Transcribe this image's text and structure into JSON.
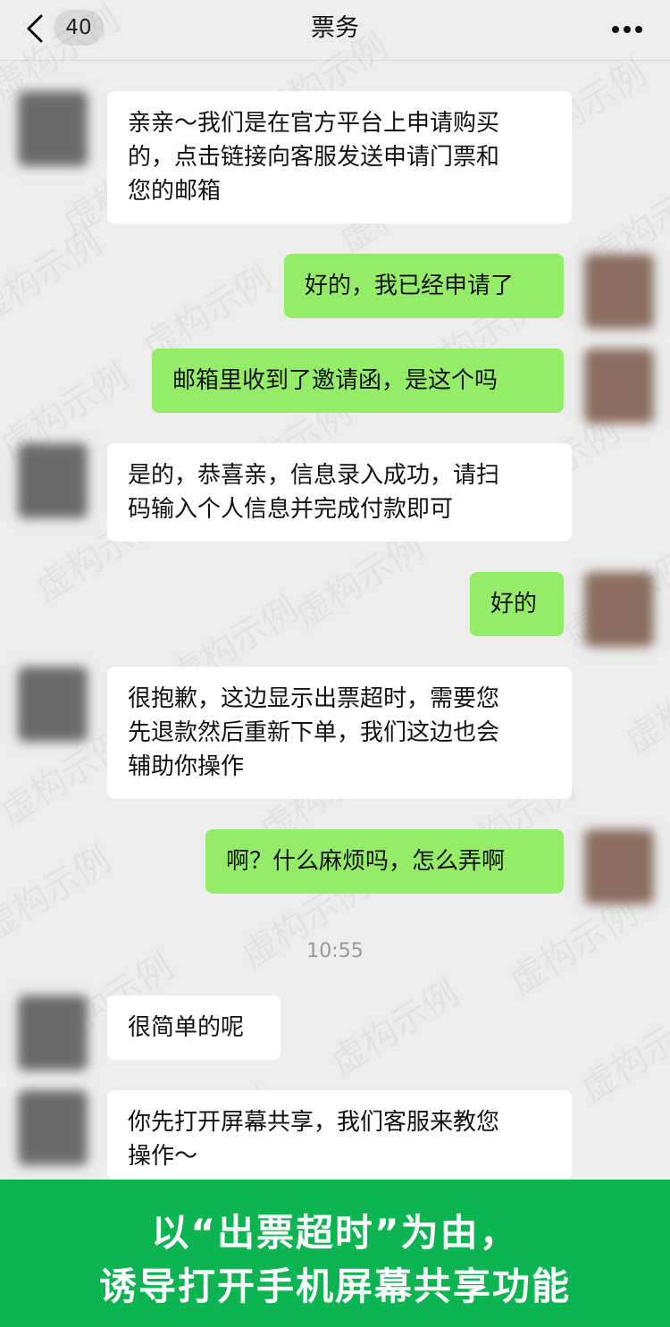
{
  "header": {
    "back_icon": "chevron-left-icon",
    "unread_count": "40",
    "title": "票务",
    "more_icon": "more-dots-icon"
  },
  "watermark_text": "虚构示例",
  "messages": [
    {
      "from": "other",
      "text": "亲亲～我们是在官方平台上申请购买\n的，点击链接向客服发送申请门票和\n您的邮箱"
    },
    {
      "from": "me",
      "text": "好的，我已经申请了"
    },
    {
      "from": "me",
      "text": "邮箱里收到了邀请函，是这个吗"
    },
    {
      "from": "other",
      "text": "是的，恭喜亲，信息录入成功，请扫\n码输入个人信息并完成付款即可"
    },
    {
      "from": "me",
      "text": "好的"
    },
    {
      "from": "other",
      "text": "很抱歉，这边显示出票超时，需要您\n先退款然后重新下单，我们这边也会\n辅助你操作"
    },
    {
      "from": "me",
      "text": "啊？什么麻烦吗，怎么弄啊"
    },
    {
      "from": "other",
      "text": "很简单的呢"
    },
    {
      "from": "other",
      "text": "你先打开屏幕共享，我们客服来教您\n操作～"
    }
  ],
  "timestamp": "10:55",
  "banner": {
    "line1": "以“出票超时”为由，",
    "line2": "诱导打开手机屏幕共享功能"
  },
  "colors": {
    "background": "#ededed",
    "bubble_other": "#ffffff",
    "bubble_me": "#95ec69",
    "banner": "#0cb452"
  }
}
